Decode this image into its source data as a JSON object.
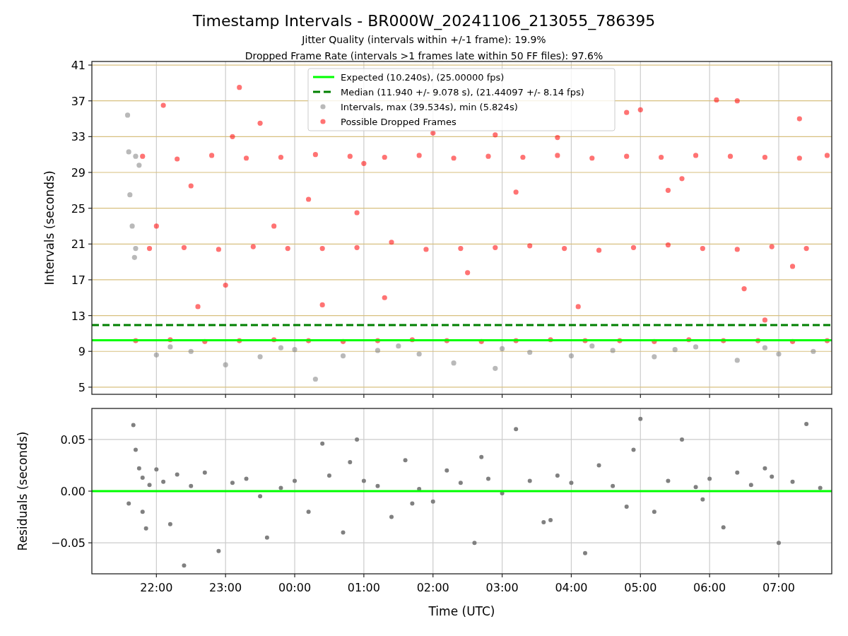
{
  "figure": {
    "title": "Timestamp Intervals - BR000W_20241106_213055_786395",
    "subtitles": [
      "Jitter Quality (intervals within +/-1 frame): 19.9%",
      "Dropped Frame Rate (intervals >1 frames late within 50 FF files): 97.6%"
    ]
  },
  "charts": [
    {
      "chart_data": {
        "type": "scatter",
        "ylabel": "Intervals (seconds)",
        "grid": true,
        "legend": "upper center",
        "xlim": [
          "2024-11-06T21:04",
          "2024-11-07T07:46"
        ],
        "ylim": [
          4.2,
          41.4
        ],
        "yticks": [
          5,
          9,
          13,
          17,
          21,
          25,
          29,
          33,
          37,
          41
        ],
        "ref_lines": [
          {
            "axis": "y",
            "value": 10.24,
            "label": "Expected (10.240s), (25.00000 fps)",
            "color": "#00ff00"
          },
          {
            "axis": "y",
            "value": 11.94,
            "label": "Median (11.940 +/- 9.078 s), (21.44097 +/- 8.14 fps)",
            "color": "#008000"
          }
        ],
        "series": [
          {
            "name": "Intervals, max (39.534s), min (5.824s)",
            "color": "#808080",
            "x": [
              "2024-11-06T21:35",
              "2024-11-06T21:36",
              "2024-11-06T21:37",
              "2024-11-06T21:39",
              "2024-11-06T21:42",
              "2024-11-06T21:41",
              "2024-11-06T21:42",
              "2024-11-06T21:45",
              "2024-11-06T22:00",
              "2024-11-06T22:30",
              "2024-11-06T23:00",
              "2024-11-06T23:30",
              "2024-11-07T00:00",
              "2024-11-07T00:18",
              "2024-11-07T00:42",
              "2024-11-07T01:12",
              "2024-11-07T01:48",
              "2024-11-07T02:18",
              "2024-11-07T02:54",
              "2024-11-07T03:24",
              "2024-11-07T04:00",
              "2024-11-07T04:36",
              "2024-11-07T05:12",
              "2024-11-07T05:48",
              "2024-11-07T06:24",
              "2024-11-07T07:00",
              "2024-11-07T07:30",
              "2024-11-06T22:12",
              "2024-11-06T23:48",
              "2024-11-07T01:30",
              "2024-11-07T03:00",
              "2024-11-07T04:18",
              "2024-11-07T05:30",
              "2024-11-07T06:48"
            ],
            "values": [
              35.4,
              31.3,
              26.5,
              23.0,
              20.5,
              19.5,
              30.8,
              29.8,
              8.6,
              9.0,
              7.5,
              8.4,
              9.2,
              5.9,
              8.5,
              9.1,
              8.7,
              7.7,
              7.1,
              8.9,
              8.5,
              9.1,
              8.4,
              9.5,
              8.0,
              8.7,
              9.0,
              9.5,
              9.4,
              9.6,
              9.3,
              9.6,
              9.2,
              9.4
            ]
          },
          {
            "name": "Possible Dropped Frames",
            "color": "#ff0000",
            "x": [
              "2024-11-06T21:48",
              "2024-11-06T22:18",
              "2024-11-06T22:48",
              "2024-11-06T23:18",
              "2024-11-06T23:48",
              "2024-11-07T00:18",
              "2024-11-07T00:48",
              "2024-11-07T01:18",
              "2024-11-07T01:48",
              "2024-11-07T02:18",
              "2024-11-07T02:48",
              "2024-11-07T03:18",
              "2024-11-07T03:48",
              "2024-11-07T04:18",
              "2024-11-07T04:48",
              "2024-11-07T05:18",
              "2024-11-07T05:48",
              "2024-11-07T06:18",
              "2024-11-07T06:48",
              "2024-11-07T07:18",
              "2024-11-07T07:42",
              "2024-11-06T21:54",
              "2024-11-06T22:24",
              "2024-11-06T22:54",
              "2024-11-06T23:24",
              "2024-11-06T23:54",
              "2024-11-07T00:24",
              "2024-11-07T00:54",
              "2024-11-07T01:24",
              "2024-11-07T01:54",
              "2024-11-07T02:24",
              "2024-11-07T02:54",
              "2024-11-07T03:24",
              "2024-11-07T03:54",
              "2024-11-07T04:24",
              "2024-11-07T04:54",
              "2024-11-07T05:24",
              "2024-11-07T05:54",
              "2024-11-07T06:24",
              "2024-11-07T06:54",
              "2024-11-07T07:24",
              "2024-11-06T21:42",
              "2024-11-06T22:12",
              "2024-11-06T22:42",
              "2024-11-06T23:12",
              "2024-11-06T23:42",
              "2024-11-07T00:12",
              "2024-11-07T00:42",
              "2024-11-07T01:12",
              "2024-11-07T01:42",
              "2024-11-07T02:12",
              "2024-11-07T02:42",
              "2024-11-07T03:12",
              "2024-11-07T03:42",
              "2024-11-07T04:12",
              "2024-11-07T04:42",
              "2024-11-07T05:12",
              "2024-11-07T05:42",
              "2024-11-07T06:12",
              "2024-11-07T06:42",
              "2024-11-07T07:12",
              "2024-11-07T07:42",
              "2024-11-06T22:06",
              "2024-11-06T22:36",
              "2024-11-06T23:12",
              "2024-11-06T23:30",
              "2024-11-06T23:00",
              "2024-11-07T00:24",
              "2024-11-07T00:12",
              "2024-11-07T01:18",
              "2024-11-07T02:00",
              "2024-11-07T02:30",
              "2024-11-07T03:12",
              "2024-11-07T03:48",
              "2024-11-07T04:06",
              "2024-11-07T04:48",
              "2024-11-07T05:00",
              "2024-11-07T05:24",
              "2024-11-07T06:06",
              "2024-11-07T06:24",
              "2024-11-07T06:30",
              "2024-11-07T07:12",
              "2024-11-07T07:18",
              "2024-11-06T22:30",
              "2024-11-06T23:06",
              "2024-11-07T01:00",
              "2024-11-07T02:54",
              "2024-11-07T00:54",
              "2024-11-06T22:00",
              "2024-11-06T23:42",
              "2024-11-07T05:36",
              "2024-11-07T06:48"
            ],
            "values": [
              30.8,
              30.5,
              30.9,
              30.6,
              30.7,
              31.0,
              30.8,
              30.7,
              30.9,
              30.6,
              30.8,
              30.7,
              30.9,
              30.6,
              30.8,
              30.7,
              30.9,
              30.8,
              30.7,
              30.6,
              30.9,
              20.5,
              20.6,
              20.4,
              20.7,
              20.5,
              20.5,
              20.6,
              21.2,
              20.4,
              20.5,
              20.6,
              20.8,
              20.5,
              20.3,
              20.6,
              20.9,
              20.5,
              20.4,
              20.7,
              20.5,
              10.2,
              10.3,
              10.1,
              10.2,
              10.3,
              10.2,
              10.1,
              10.2,
              10.3,
              10.2,
              10.1,
              10.2,
              10.3,
              10.2,
              10.2,
              10.1,
              10.3,
              10.2,
              10.2,
              10.1,
              10.2,
              36.5,
              14.0,
              38.5,
              34.5,
              16.4,
              14.2,
              26.0,
              15.0,
              33.4,
              17.8,
              26.8,
              32.9,
              14.0,
              35.7,
              36.0,
              27.0,
              37.1,
              37.0,
              16.0,
              18.5,
              35.0,
              27.5,
              33.0,
              30.0,
              33.2,
              24.5,
              23.0,
              23.0,
              28.3,
              12.5
            ]
          }
        ]
      }
    },
    {
      "chart_data": {
        "type": "scatter",
        "xlabel": "Time (UTC)",
        "ylabel": "Residuals (seconds)",
        "grid": true,
        "xlim": [
          "2024-11-06T21:04",
          "2024-11-07T07:46"
        ],
        "ylim": [
          -0.08,
          0.08
        ],
        "xticks": [
          {
            "value": "2024-11-06T22:00",
            "label": "22:00"
          },
          {
            "value": "2024-11-06T23:00",
            "label": "23:00"
          },
          {
            "value": "2024-11-07T00:00",
            "label": "00:00"
          },
          {
            "value": "2024-11-07T01:00",
            "label": "01:00"
          },
          {
            "value": "2024-11-07T02:00",
            "label": "02:00"
          },
          {
            "value": "2024-11-07T03:00",
            "label": "03:00"
          },
          {
            "value": "2024-11-07T04:00",
            "label": "04:00"
          },
          {
            "value": "2024-11-07T05:00",
            "label": "05:00"
          },
          {
            "value": "2024-11-07T06:00",
            "label": "06:00"
          },
          {
            "value": "2024-11-07T07:00",
            "label": "07:00"
          }
        ],
        "yticks": [
          {
            "value": -0.05,
            "label": "−0.05"
          },
          {
            "value": 0,
            "label": "0.00"
          },
          {
            "value": 0.05,
            "label": "0.05"
          }
        ],
        "ref_lines": [
          {
            "axis": "y",
            "value": 0,
            "color": "#00ff00"
          }
        ],
        "series": [
          {
            "color": "#808080",
            "x": [
              "2024-11-06T21:36",
              "2024-11-06T21:40",
              "2024-11-06T21:42",
              "2024-11-06T21:45",
              "2024-11-06T21:48",
              "2024-11-06T21:51",
              "2024-11-06T21:54",
              "2024-11-06T22:00",
              "2024-11-06T22:06",
              "2024-11-06T22:12",
              "2024-11-06T22:24",
              "2024-11-06T22:30",
              "2024-11-06T22:42",
              "2024-11-06T22:54",
              "2024-11-06T23:06",
              "2024-11-06T23:18",
              "2024-11-06T23:30",
              "2024-11-06T23:48",
              "2024-11-07T00:00",
              "2024-11-07T00:12",
              "2024-11-07T00:24",
              "2024-11-07T00:30",
              "2024-11-07T00:42",
              "2024-11-07T00:54",
              "2024-11-07T01:00",
              "2024-11-07T01:12",
              "2024-11-07T01:24",
              "2024-11-07T01:36",
              "2024-11-07T01:48",
              "2024-11-07T02:00",
              "2024-11-07T02:12",
              "2024-11-07T02:24",
              "2024-11-07T02:36",
              "2024-11-07T02:48",
              "2024-11-07T03:00",
              "2024-11-07T03:12",
              "2024-11-07T03:24",
              "2024-11-07T03:36",
              "2024-11-07T03:48",
              "2024-11-07T04:00",
              "2024-11-07T04:12",
              "2024-11-07T04:24",
              "2024-11-07T04:36",
              "2024-11-07T04:48",
              "2024-11-07T05:00",
              "2024-11-07T05:12",
              "2024-11-07T05:24",
              "2024-11-07T05:36",
              "2024-11-07T05:48",
              "2024-11-07T06:00",
              "2024-11-07T06:12",
              "2024-11-07T06:24",
              "2024-11-07T06:36",
              "2024-11-07T06:48",
              "2024-11-07T07:00",
              "2024-11-07T07:12",
              "2024-11-07T07:24",
              "2024-11-07T07:36",
              "2024-11-06T21:48",
              "2024-11-06T22:18",
              "2024-11-06T23:36",
              "2024-11-07T00:48",
              "2024-11-07T01:42",
              "2024-11-07T02:42",
              "2024-11-07T03:42",
              "2024-11-07T04:54",
              "2024-11-07T05:54",
              "2024-11-07T06:54"
            ],
            "values": [
              -0.012,
              0.064,
              0.04,
              0.022,
              0.013,
              -0.036,
              0.006,
              0.021,
              0.009,
              -0.032,
              -0.072,
              0.005,
              0.018,
              -0.058,
              0.008,
              0.012,
              -0.005,
              0.003,
              0.01,
              -0.02,
              0.046,
              0.015,
              -0.04,
              0.05,
              0.01,
              0.005,
              -0.025,
              0.03,
              0.002,
              -0.01,
              0.02,
              0.008,
              -0.05,
              0.012,
              -0.002,
              0.06,
              0.01,
              -0.03,
              0.015,
              0.008,
              -0.06,
              0.025,
              0.005,
              -0.015,
              0.07,
              -0.02,
              0.01,
              0.05,
              0.004,
              0.012,
              -0.035,
              0.018,
              0.006,
              0.022,
              -0.05,
              0.009,
              0.065,
              0.003,
              -0.02,
              0.016,
              -0.045,
              0.028,
              -0.012,
              0.033,
              -0.028,
              0.04,
              -0.008,
              0.014
            ]
          }
        ]
      }
    }
  ]
}
